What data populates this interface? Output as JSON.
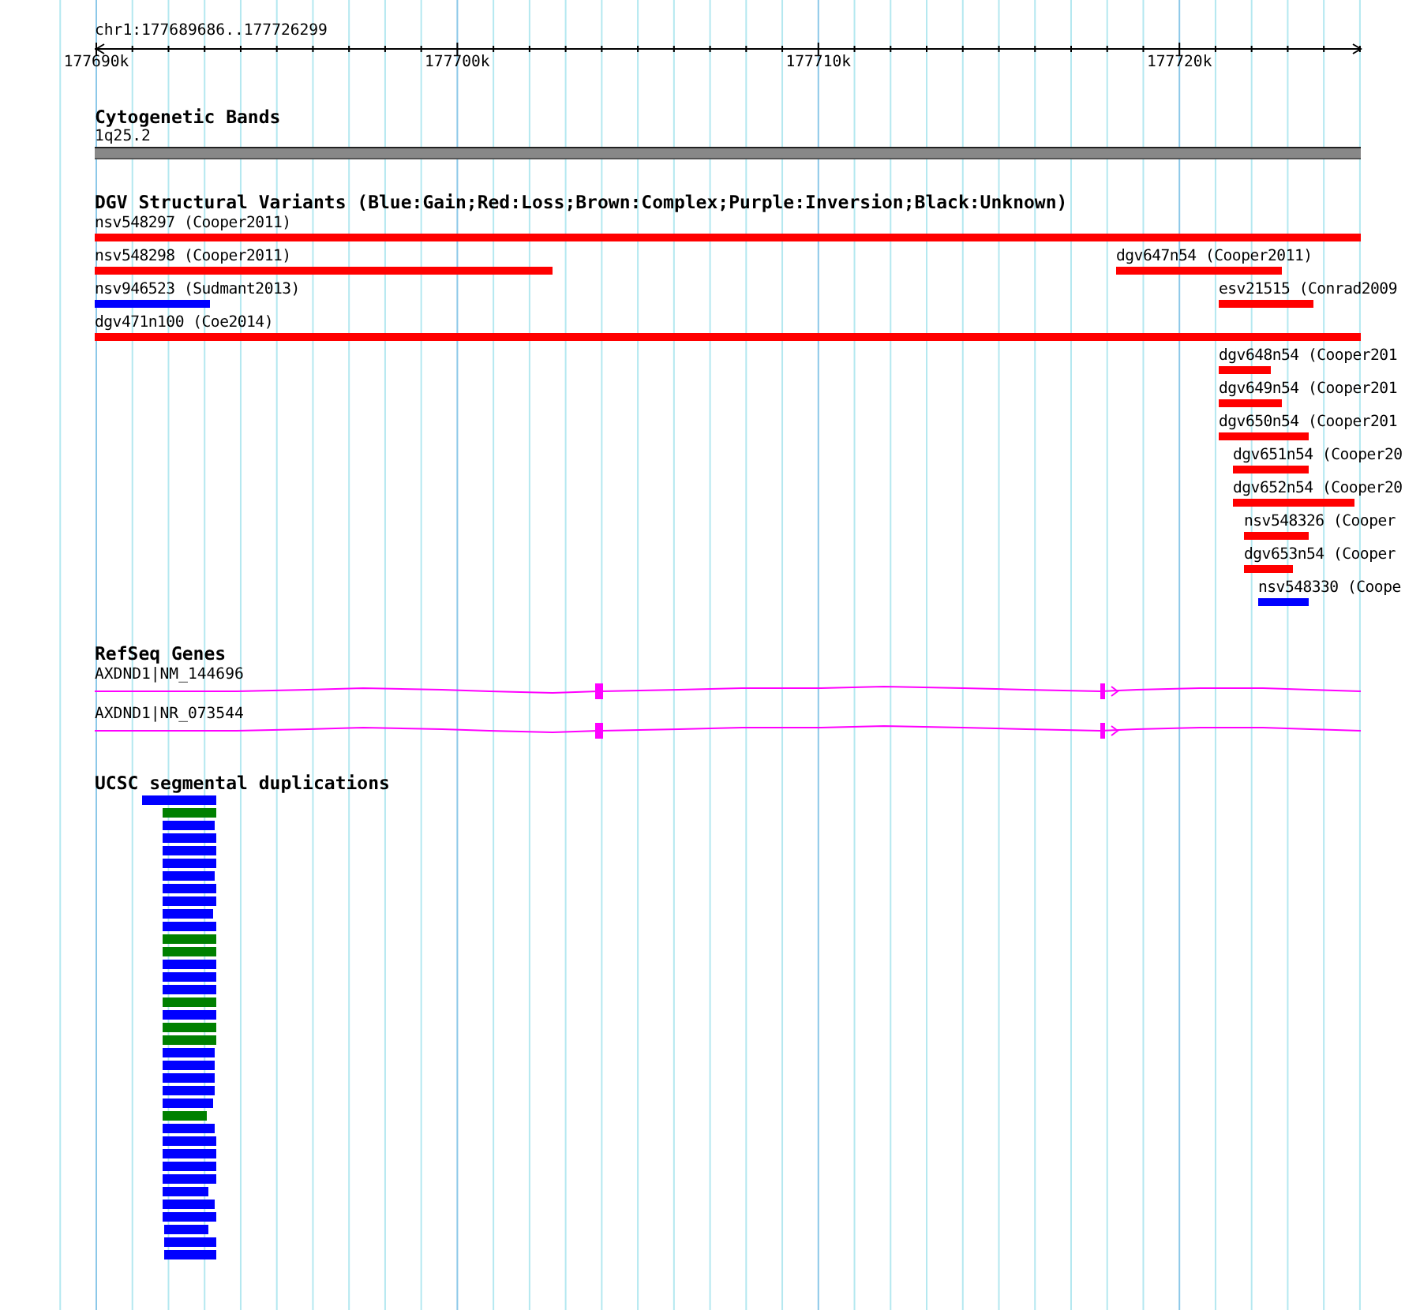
{
  "ruler": {
    "location": "chr1:177689686..177726299",
    "tick_labels": [
      "177690k",
      "177700k",
      "177710k",
      "177720k"
    ]
  },
  "cytoband": {
    "title": "Cytogenetic Bands",
    "band": "1q25.2"
  },
  "dgv": {
    "title": "DGV Structural Variants (Blue:Gain;Red:Loss;Brown:Complex;Purple:Inversion;Black:Unknown)",
    "features": [
      {
        "label": "nsv548297 (Cooper2011)",
        "color": "#ff0000"
      },
      {
        "label": "nsv548298 (Cooper2011)",
        "color": "#ff0000"
      },
      {
        "label": "dgv647n54 (Cooper2011)",
        "color": "#ff0000"
      },
      {
        "label": "nsv946523 (Sudmant2013)",
        "color": "#0000ff"
      },
      {
        "label": "esv21515 (Conrad2009",
        "color": "#ff0000"
      },
      {
        "label": "dgv471n100 (Coe2014)",
        "color": "#ff0000"
      },
      {
        "label": "dgv648n54 (Cooper201",
        "color": "#ff0000"
      },
      {
        "label": "dgv649n54 (Cooper201",
        "color": "#ff0000"
      },
      {
        "label": "dgv650n54 (Cooper201",
        "color": "#ff0000"
      },
      {
        "label": "dgv651n54 (Cooper20",
        "color": "#ff0000"
      },
      {
        "label": "dgv652n54 (Cooper20",
        "color": "#ff0000"
      },
      {
        "label": "nsv548326 (Cooper",
        "color": "#ff0000"
      },
      {
        "label": "dgv653n54 (Cooper",
        "color": "#ff0000"
      },
      {
        "label": "nsv548330 (Coope",
        "color": "#0000ff"
      }
    ]
  },
  "refseq": {
    "title": "RefSeq Genes",
    "genes": [
      {
        "label": "AXDND1|NM_144696"
      },
      {
        "label": "AXDND1|NR_073544"
      }
    ]
  },
  "segdups": {
    "title": "UCSC segmental duplications",
    "features": [
      {
        "color": "#0000ff"
      },
      {
        "color": "#008000"
      },
      {
        "color": "#0000ff"
      },
      {
        "color": "#0000ff"
      },
      {
        "color": "#0000ff"
      },
      {
        "color": "#0000ff"
      },
      {
        "color": "#0000ff"
      },
      {
        "color": "#0000ff"
      },
      {
        "color": "#0000ff"
      },
      {
        "color": "#0000ff"
      },
      {
        "color": "#0000ff"
      },
      {
        "color": "#008000"
      },
      {
        "color": "#008000"
      },
      {
        "color": "#0000ff"
      },
      {
        "color": "#0000ff"
      },
      {
        "color": "#0000ff"
      },
      {
        "color": "#008000"
      },
      {
        "color": "#0000ff"
      },
      {
        "color": "#008000"
      },
      {
        "color": "#008000"
      },
      {
        "color": "#0000ff"
      },
      {
        "color": "#0000ff"
      },
      {
        "color": "#0000ff"
      },
      {
        "color": "#0000ff"
      },
      {
        "color": "#0000ff"
      },
      {
        "color": "#008000"
      },
      {
        "color": "#0000ff"
      },
      {
        "color": "#0000ff"
      },
      {
        "color": "#0000ff"
      },
      {
        "color": "#0000ff"
      },
      {
        "color": "#0000ff"
      },
      {
        "color": "#0000ff"
      },
      {
        "color": "#0000ff"
      },
      {
        "color": "#0000ff"
      },
      {
        "color": "#0000ff"
      },
      {
        "color": "#0000ff"
      },
      {
        "color": "#0000ff"
      }
    ]
  }
}
